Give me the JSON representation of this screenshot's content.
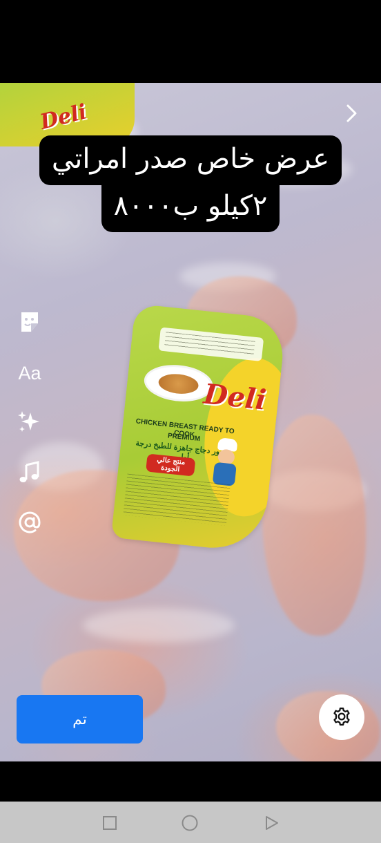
{
  "caption": {
    "line1": "عرض خاص صدر امراتي",
    "line2": "٢كيلو ب٨٠٠٠"
  },
  "tools": [
    {
      "name": "sticker-icon"
    },
    {
      "name": "text-tool",
      "label": "Aa"
    },
    {
      "name": "effects-sparkle-icon"
    },
    {
      "name": "music-note-icon"
    },
    {
      "name": "mention-icon"
    }
  ],
  "done_button": {
    "label": "تم"
  },
  "settings": {
    "icon": "gear-icon"
  },
  "system_nav": [
    "recent-apps-square-icon",
    "home-circle-icon",
    "back-triangle-icon"
  ],
  "colors": {
    "accent": "#1877f2",
    "caption_bg": "#000000",
    "caption_text": "#ffffff"
  }
}
